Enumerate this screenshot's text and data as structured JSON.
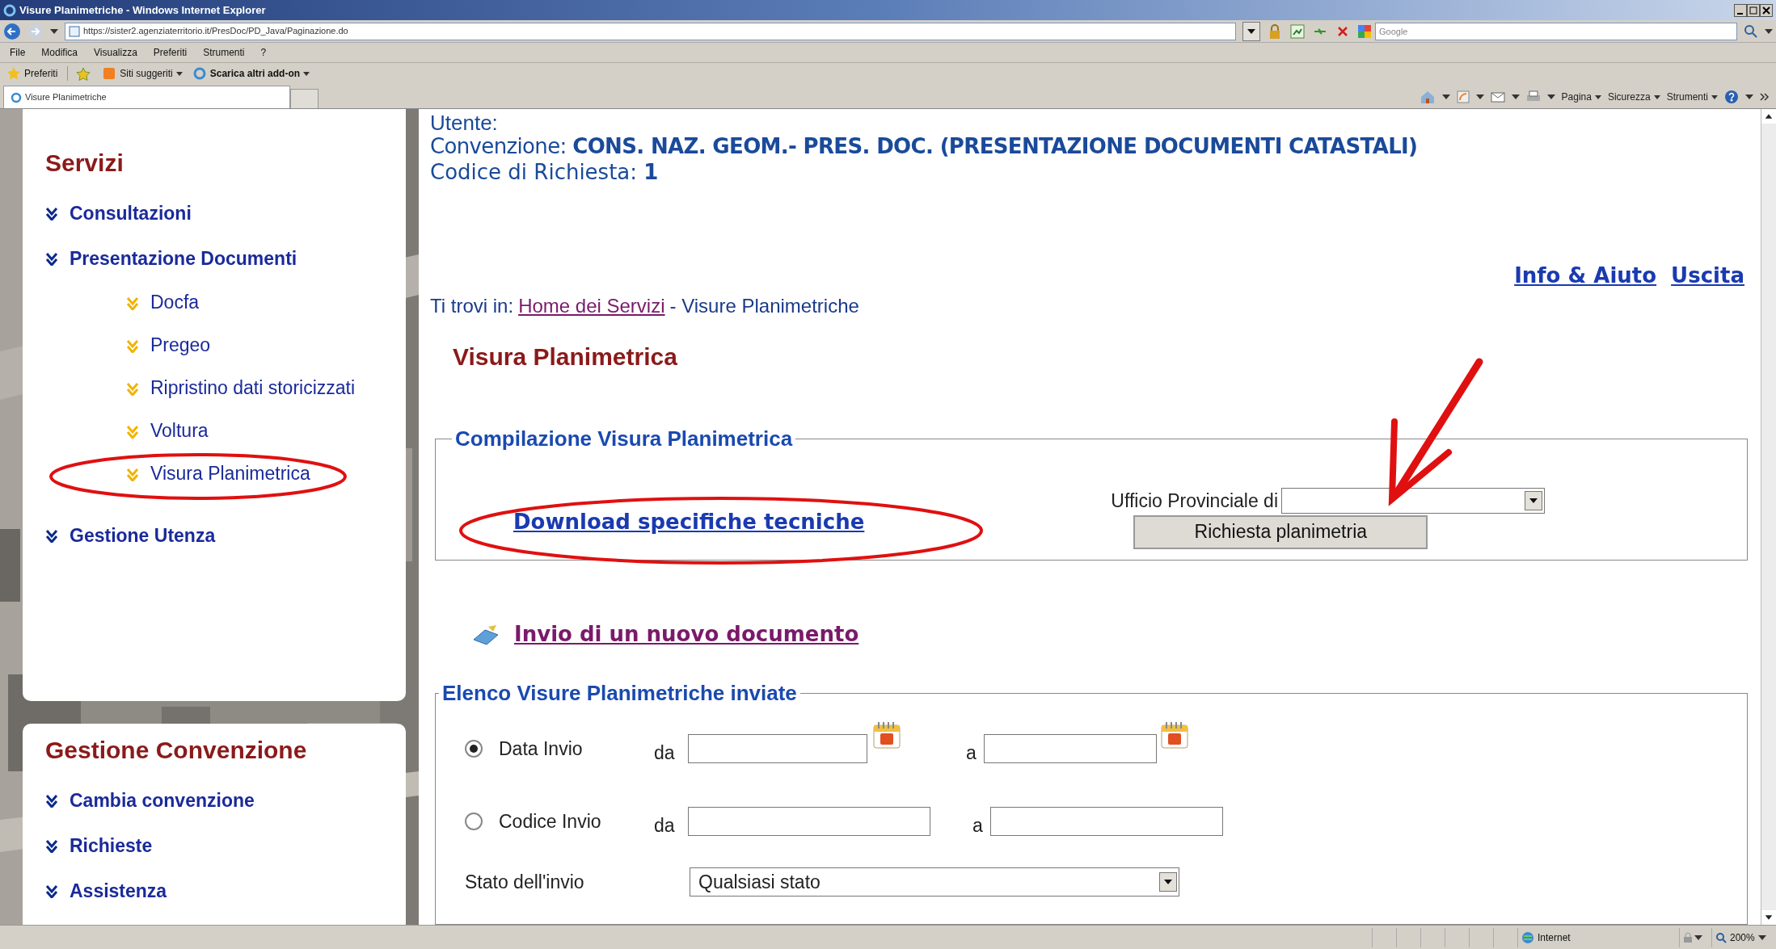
{
  "window": {
    "title": "Visure Planimetriche - Windows Internet Explorer"
  },
  "address_bar": {
    "url": "https://sister2.agenziaterritorio.it/PresDoc/PD_Java/Paginazione.do",
    "search_placeholder": "Google"
  },
  "menu": [
    "File",
    "Modifica",
    "Visualizza",
    "Preferiti",
    "Strumenti",
    "?"
  ],
  "favorites_bar": [
    {
      "label": "Preferiti",
      "kind": "star"
    },
    {
      "label": "Siti suggeriti",
      "kind": "dropdown"
    },
    {
      "label": "Scarica altri add-on",
      "kind": "bold"
    }
  ],
  "tab": {
    "label": "Visure Planimetriche"
  },
  "command_bar": [
    "Pagina",
    "Sicurezza",
    "Strumenti"
  ],
  "sidebar": [
    {
      "title": "Servizi",
      "items": [
        {
          "label": "Consultazioni"
        },
        {
          "label": "Presentazione Documenti",
          "children": [
            {
              "label": "Docfa"
            },
            {
              "label": "Pregeo"
            },
            {
              "label": "Ripristino dati storicizzati"
            },
            {
              "label": "Voltura"
            },
            {
              "label": "Visura Planimetrica"
            }
          ]
        },
        {
          "label": "Gestione Utenza"
        }
      ]
    },
    {
      "title": "Gestione Convenzione",
      "items": [
        {
          "label": "Cambia convenzione"
        },
        {
          "label": "Richieste"
        },
        {
          "label": "Assistenza"
        }
      ]
    }
  ],
  "header": {
    "user_label": "Utente:",
    "convention_label": "Convenzione:",
    "convention": "CONS. NAZ. GEOM.- PRES. DOC. (PRESENTAZIONE DOCUMENTI CATASTALI)",
    "request_label": "Codice di Richiesta:",
    "request_code": "1",
    "links": [
      "Info & Aiuto",
      "Uscita"
    ]
  },
  "breadcrumb": {
    "prefix": "Ti trovi in:",
    "link": "Home dei Servizi",
    "current": "- Visure Planimetriche"
  },
  "page_title": "Visura Planimetrica",
  "compile_section": {
    "legend": "Compilazione Visura Planimetrica",
    "download_link": "Download specifiche tecniche",
    "office_label": "Ufficio Provinciale di",
    "button": "Richiesta planimetria"
  },
  "new_document_link": "Invio di un nuovo documento",
  "list_section": {
    "legend": "Elenco Visure Planimetriche inviate",
    "filters": [
      {
        "label": "Data Invio",
        "selected": true,
        "kind": "date",
        "from": "da",
        "to": "a"
      },
      {
        "label": "Codice Invio",
        "selected": false,
        "kind": "code",
        "from": "da",
        "to": "a"
      }
    ],
    "status_label": "Stato dell'invio",
    "status_value": "Qualsiasi stato"
  },
  "status_bar": {
    "zone": "Internet",
    "zoom": "200%"
  }
}
